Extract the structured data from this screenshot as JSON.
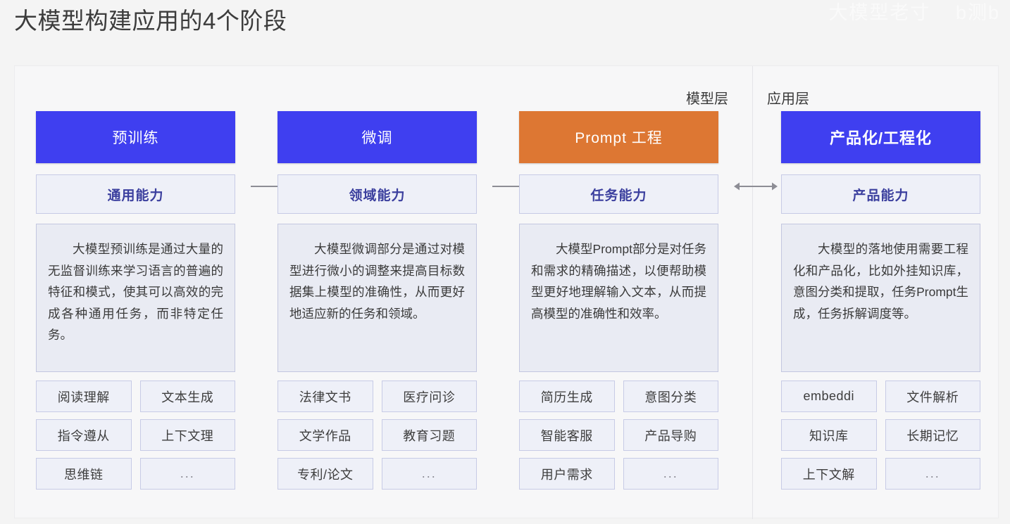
{
  "page": {
    "title": "大模型构建应用的4个阶段",
    "watermark_left": "大模型老寸",
    "watermark_right": "b测b",
    "accent_blue": "#3f3ff0",
    "accent_orange": "#dd7733",
    "panel_bg": "#f7f7f8",
    "chip_bg": "#eef0f8",
    "chip_border": "#c7cbe6",
    "desc_bg": "#e9ebf3"
  },
  "layers": {
    "model_label": "模型层",
    "app_label": "应用层"
  },
  "arrows": [
    {
      "name": "arrow-pretrain-to-finetune",
      "direction": "right"
    },
    {
      "name": "arrow-finetune-to-prompt",
      "direction": "right"
    },
    {
      "name": "arrow-prompt-to-product",
      "direction": "both"
    }
  ],
  "columns": [
    {
      "stage": "预训练",
      "stage_color": "blue",
      "capability": "通用能力",
      "description": "大模型预训练是通过大量的无监督训练来学习语言的普遍的特征和模式，使其可以高效的完成各种通用任务，而非特定任务。",
      "chips": [
        "阅读理解",
        "文本生成",
        "指令遵从",
        "上下文理",
        "思维链",
        "..."
      ]
    },
    {
      "stage": "微调",
      "stage_color": "blue",
      "capability": "领域能力",
      "description": "大模型微调部分是通过对模型进行微小的调整来提高目标数据集上模型的准确性，从而更好地适应新的任务和领域。",
      "chips": [
        "法律文书",
        "医疗问诊",
        "文学作品",
        "教育习题",
        "专利/论文",
        "..."
      ]
    },
    {
      "stage": "Prompt 工程",
      "stage_color": "orange",
      "capability": "任务能力",
      "description": "大模型Prompt部分是对任务和需求的精确描述，以便帮助模型更好地理解输入文本，从而提高模型的准确性和效率。",
      "chips": [
        "简历生成",
        "意图分类",
        "智能客服",
        "产品导购",
        "用户需求",
        "..."
      ]
    },
    {
      "stage": "产品化/工程化",
      "stage_color": "blue",
      "capability": "产品能力",
      "description": "大模型的落地使用需要工程化和产品化，比如外挂知识库，意图分类和提取，任务Prompt生成，任务拆解调度等。",
      "chips": [
        "embeddi",
        "文件解析",
        "知识库",
        "长期记忆",
        "上下文解",
        "..."
      ]
    }
  ]
}
